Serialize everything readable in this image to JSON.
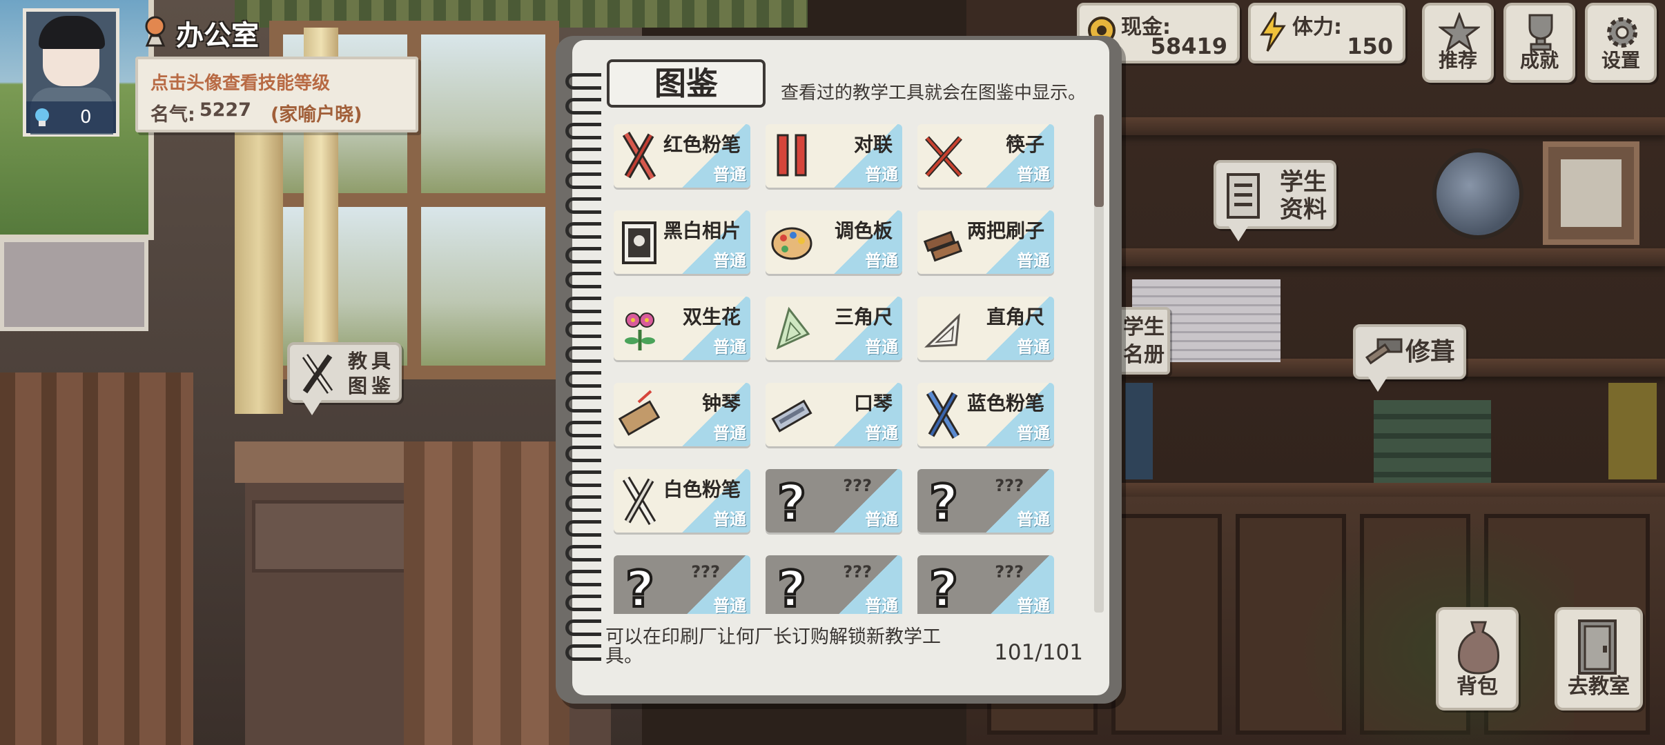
{
  "location": {
    "name": "办公室"
  },
  "avatar": {
    "level": "0"
  },
  "profile": {
    "hint": "点击头像查看技能等级",
    "fame_label": "名气:",
    "fame_value": "5227",
    "fame_title": "(家喻户晓)"
  },
  "stats": {
    "cash": {
      "label": "现金:",
      "value": "58419",
      "icon": "gear-coin-icon"
    },
    "stamina": {
      "label": "体力:",
      "value": "150",
      "icon": "lightning-icon"
    }
  },
  "top_buttons": [
    {
      "label": "推荐",
      "icon": "star-icon"
    },
    {
      "label": "成就",
      "icon": "trophy-icon"
    },
    {
      "label": "设置",
      "icon": "gear-icon"
    }
  ],
  "world_labels": {
    "student_info": "学生资料",
    "student_roster": "学生名册",
    "repair": "修葺",
    "tool_encyclopedia": "教具图鉴"
  },
  "bottom_buttons": [
    {
      "label": "背包",
      "icon": "bag-icon"
    },
    {
      "label": "去教室",
      "icon": "door-icon"
    }
  ],
  "encyclopedia": {
    "title": "图鉴",
    "subtitle": "查看过的教学工具就会在图鉴中显示。",
    "footer_note": "可以在印刷厂让何厂长订购解锁新教学工具。",
    "count": "101/101",
    "scroll_position": 0.0,
    "items": [
      {
        "name": "红色粉笔",
        "rarity": "普通",
        "icon": "red-chalk-icon",
        "locked": false
      },
      {
        "name": "对联",
        "rarity": "普通",
        "icon": "couplet-icon",
        "locked": false
      },
      {
        "name": "筷子",
        "rarity": "普通",
        "icon": "chopsticks-icon",
        "locked": false
      },
      {
        "name": "黑白相片",
        "rarity": "普通",
        "icon": "photo-icon",
        "locked": false
      },
      {
        "name": "调色板",
        "rarity": "普通",
        "icon": "palette-icon",
        "locked": false
      },
      {
        "name": "两把刷子",
        "rarity": "普通",
        "icon": "brushes-icon",
        "locked": false
      },
      {
        "name": "双生花",
        "rarity": "普通",
        "icon": "flower-icon",
        "locked": false
      },
      {
        "name": "三角尺",
        "rarity": "普通",
        "icon": "triangle-ruler-icon",
        "locked": false
      },
      {
        "name": "直角尺",
        "rarity": "普通",
        "icon": "right-angle-ruler-icon",
        "locked": false
      },
      {
        "name": "钟琴",
        "rarity": "普通",
        "icon": "glockenspiel-icon",
        "locked": false
      },
      {
        "name": "口琴",
        "rarity": "普通",
        "icon": "harmonica-icon",
        "locked": false
      },
      {
        "name": "蓝色粉笔",
        "rarity": "普通",
        "icon": "blue-chalk-icon",
        "locked": false
      },
      {
        "name": "白色粉笔",
        "rarity": "普通",
        "icon": "white-chalk-icon",
        "locked": false
      },
      {
        "name": "???",
        "rarity": "普通",
        "icon": "question-mark-icon",
        "locked": true
      },
      {
        "name": "???",
        "rarity": "普通",
        "icon": "question-mark-icon",
        "locked": true
      },
      {
        "name": "???",
        "rarity": "普通",
        "icon": "question-mark-icon",
        "locked": true
      },
      {
        "name": "???",
        "rarity": "普通",
        "icon": "question-mark-icon",
        "locked": true
      },
      {
        "name": "???",
        "rarity": "普通",
        "icon": "question-mark-icon",
        "locked": true
      }
    ]
  },
  "colors": {
    "rarity_common": "#a9d8ea",
    "card_bg": "#f3efe1",
    "card_locked_bg": "#918e89",
    "hint_text": "#b86a44"
  }
}
